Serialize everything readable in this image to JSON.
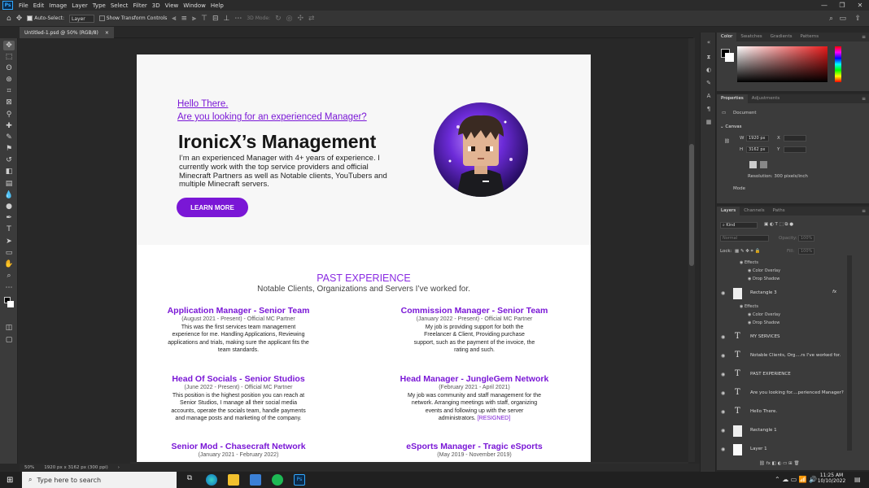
{
  "app": {
    "logo": "Ps",
    "menus": [
      "File",
      "Edit",
      "Image",
      "Layer",
      "Type",
      "Select",
      "Filter",
      "3D",
      "View",
      "Window",
      "Help"
    ]
  },
  "options": {
    "auto_select": "Auto-Select:",
    "auto_select_target": "Layer",
    "transform_controls": "Show Transform Controls",
    "mode_3d": "3D Mode:"
  },
  "document_tab": {
    "title": "Untitled-1.psd @ 50% (RGB/8)",
    "close": "×"
  },
  "status": {
    "zoom": "50%",
    "doc_info": "1920 px x 3162 px (300 ppi)"
  },
  "artwork": {
    "hello": "Hello There.",
    "question": "Are you looking for an experienced Manager?",
    "heading": "IronicX’s Management",
    "intro": "I’m an experienced Manager with 4+ years of experience. I currently work with the top service providers and official Minecraft Partners as well as Notable clients, YouTubers and multiple Minecraft servers.",
    "cta": "LEARN MORE",
    "past_title": "PAST EXPERIENCE",
    "past_subtitle": "Notable Clients, Organizations and Servers I’ve worked for.",
    "jobs": [
      {
        "title": "Application Manager - Senior Team",
        "dates": "(August 2021 - Present) - Official MC Partner",
        "body": "This was the first services team management experience for me. Handling Applications, Reviewing applications and trials, making sure the applicant fits the team standards."
      },
      {
        "title": "Commission Manager - Senior Team",
        "dates": "(January 2022 - Present) - Official MC Partner",
        "body": "My job is  providing support for both the Freelancer & Client, Providing purchase support, such as the payment of the invoice, the rating and such."
      },
      {
        "title": "Head Of Socials - Senior Studios",
        "dates": "(June 2022 - Present) - Official MC Partner",
        "body": "This position is the highest position you can reach at Senior Studios, I manage all their social media accounts, operate the socials team, handle payments and manage posts and marketing of the company."
      },
      {
        "title": "Head Manager - JungleGem Network",
        "dates": "(February 2021 - April 2021)",
        "body": "My job was community and staff management for the network. Arranging meetings with staff, organizing events and following up with the server administrators.",
        "tag": "[RESIGNED]"
      },
      {
        "title": "Senior Mod - Chasecraft Network",
        "dates": "(January 2021 - February 2022)"
      },
      {
        "title": "eSports Manager - Tragic eSports",
        "dates": "(May 2019 - November 2019)"
      }
    ]
  },
  "color_panel": {
    "tabs": [
      "Color",
      "Swatches",
      "Gradients",
      "Patterns"
    ]
  },
  "properties_panel": {
    "tabs": [
      "Properties",
      "Adjustments"
    ],
    "doc_label": "Document",
    "canvas_label": "Canvas",
    "w_label": "W",
    "w_value": "1920 px",
    "h_label": "H",
    "h_value": "3162 px",
    "x_label": "X",
    "y_label": "Y",
    "resolution": "Resolution: 300 pixels/inch",
    "mode_label": "Mode"
  },
  "layers_panel": {
    "tabs": [
      "Layers",
      "Channels",
      "Paths"
    ],
    "kind": "Kind",
    "blend": "Normal",
    "opacity_label": "Opacity:",
    "opacity": "100%",
    "lock_label": "Lock:",
    "fill_label": "Fill:",
    "fill": "100%",
    "effects_top": [
      "Effects",
      "Color Overlay",
      "Drop Shadow"
    ],
    "layers": [
      {
        "name": "Rectangle 3",
        "type": "shape",
        "fx": "fx"
      },
      {
        "name": "MY SERVICES",
        "type": "text"
      },
      {
        "name": "Notable Clients, Org....rs I've worked for.",
        "type": "text"
      },
      {
        "name": "PAST EXPERIENCE",
        "type": "text"
      },
      {
        "name": "Are you looking for....perienced Manager?",
        "type": "text"
      },
      {
        "name": "Hello There.",
        "type": "text"
      },
      {
        "name": "Rectangle 1",
        "type": "shape"
      },
      {
        "name": "Layer 1",
        "type": "fill"
      }
    ],
    "effects_rect3": [
      "Effects",
      "Color Overlay",
      "Drop Shadow"
    ]
  },
  "taskbar": {
    "search": "Type here to search",
    "time": "11:25 AM",
    "date": "10/10/2022"
  },
  "colors": {
    "accent": "#7a17d6",
    "ps_blue": "#31a8ff"
  }
}
